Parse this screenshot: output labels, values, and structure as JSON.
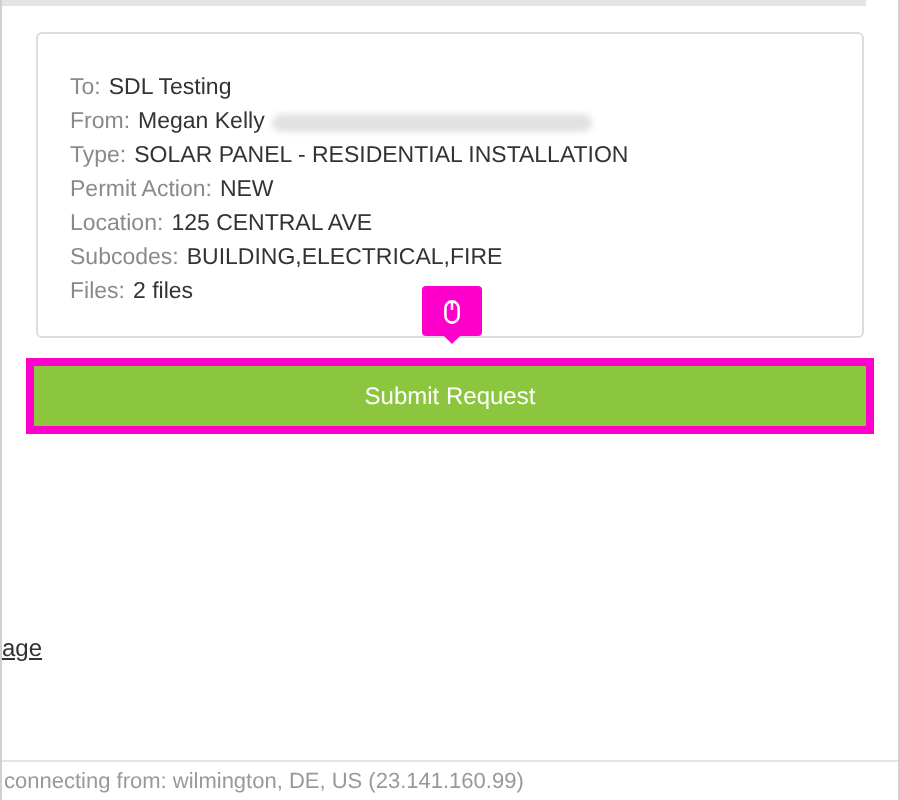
{
  "summary": {
    "rows": [
      {
        "label": "To:",
        "value": "SDL Testing",
        "redacted": false
      },
      {
        "label": "From:",
        "value": "Megan Kelly",
        "redacted": true
      },
      {
        "label": "Type:",
        "value": "SOLAR PANEL - RESIDENTIAL INSTALLATION",
        "redacted": false
      },
      {
        "label": "Permit Action:",
        "value": "NEW",
        "redacted": false
      },
      {
        "label": "Location:",
        "value": "125 CENTRAL AVE",
        "redacted": false
      },
      {
        "label": "Subcodes:",
        "value": "BUILDING,ELECTRICAL,FIRE",
        "redacted": false
      },
      {
        "label": "Files:",
        "value": "2 files",
        "redacted": false
      }
    ]
  },
  "submit_button": {
    "label": "Submit Request",
    "highlighted": true
  },
  "link": "age",
  "footer": "connecting from: wilmington, DE, US (23.141.160.99)"
}
